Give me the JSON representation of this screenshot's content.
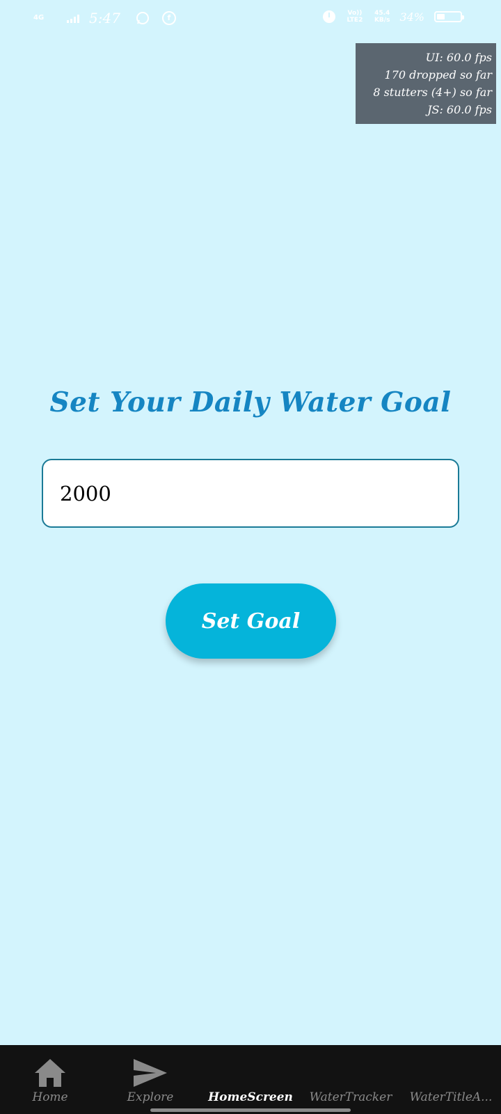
{
  "status_bar": {
    "network_type": "4G",
    "time": "5:47",
    "app_icon_letter": "f",
    "volte_label": "Vo)) LTE2",
    "speed_value": "45.4",
    "speed_unit": "KB/s",
    "battery_percent": "34%",
    "battery_level": 0.34,
    "icons": [
      "signal-icon",
      "whatsapp-icon",
      "facebook-icon",
      "alarm-icon",
      "battery-icon"
    ]
  },
  "perf_monitor": {
    "ui_fps": "UI: 60.0 fps",
    "dropped": "170 dropped so far",
    "stutters": "8 stutters (4+) so far",
    "js_fps": "JS: 60.0 fps"
  },
  "main": {
    "title": "Set Your Daily Water Goal",
    "goal_value": "2000",
    "set_goal_label": "Set Goal"
  },
  "tab_bar": {
    "tabs": [
      {
        "label": "Home",
        "icon": "home-icon",
        "active": false
      },
      {
        "label": "Explore",
        "icon": "send-icon",
        "active": false
      },
      {
        "label": "HomeScreen",
        "icon": "",
        "active": true
      },
      {
        "label": "WaterTracker",
        "icon": "",
        "active": false
      },
      {
        "label": "WaterTitleA...",
        "icon": "",
        "active": false
      }
    ]
  },
  "colors": {
    "background": "#d3f4fd",
    "title": "#1585c2",
    "button": "#05b4da",
    "input_border": "#1a7a96",
    "tab_bar": "#121212",
    "perf_bg": "#5b6670"
  }
}
